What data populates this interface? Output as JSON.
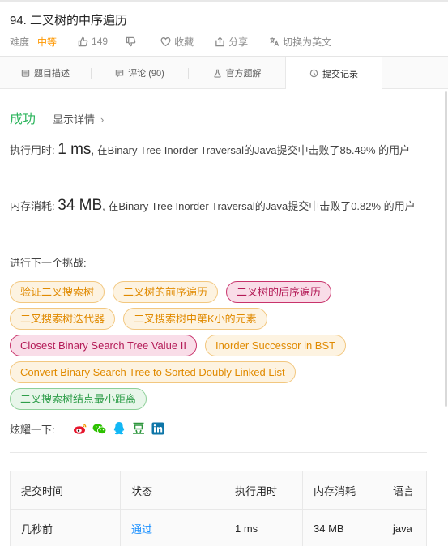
{
  "problem": {
    "title": "94. 二叉树的中序遍历",
    "difficulty_label": "难度",
    "difficulty": "中等",
    "likes": "149",
    "favorite_label": "收藏",
    "share_label": "分享",
    "switch_lang_label": "切换为英文"
  },
  "tabs": [
    {
      "label": "题目描述",
      "icon": "document-icon"
    },
    {
      "label": "评论 (90)",
      "icon": "comment-icon"
    },
    {
      "label": "官方题解",
      "icon": "flask-icon"
    },
    {
      "label": "提交记录",
      "icon": "clock-icon"
    }
  ],
  "result": {
    "status": "成功",
    "detail_link": "显示详情",
    "runtime_prefix": "执行用时:",
    "runtime_value": "1 ms",
    "runtime_suffix": ", 在Binary Tree Inorder Traversal的Java提交中击败了85.49% 的用户",
    "memory_prefix": "内存消耗:",
    "memory_value": "34 MB",
    "memory_suffix": ", 在Binary Tree Inorder Traversal的Java提交中击败了0.82% 的用户"
  },
  "challenge": {
    "title": "进行下一个挑战:",
    "rows": [
      [
        {
          "label": "验证二叉搜索树",
          "level": "medium"
        },
        {
          "label": "二叉树的前序遍历",
          "level": "medium"
        },
        {
          "label": "二叉树的后序遍历",
          "level": "hard"
        }
      ],
      [
        {
          "label": "二叉搜索树迭代器",
          "level": "medium"
        },
        {
          "label": "二叉搜索树中第K小的元素",
          "level": "medium"
        }
      ],
      [
        {
          "label": "Closest Binary Search Tree Value II",
          "level": "hard"
        },
        {
          "label": "Inorder Successor in BST",
          "level": "medium"
        }
      ],
      [
        {
          "label": "Convert Binary Search Tree to Sorted Doubly Linked List",
          "level": "medium"
        }
      ],
      [
        {
          "label": "二叉搜索树结点最小距离",
          "level": "green"
        }
      ]
    ]
  },
  "share": {
    "label": "炫耀一下:",
    "icons": [
      "weibo-icon",
      "wechat-icon",
      "qq-icon",
      "douban-icon",
      "linkedin-icon"
    ]
  },
  "colors": {
    "success": "#2db55d",
    "medium": "#e08a00",
    "hard": "#b41b57",
    "easy": "#2f9e4a",
    "link": "#1a90ff"
  },
  "submissions": {
    "headers": [
      "提交时间",
      "状态",
      "执行用时",
      "内存消耗",
      "语言"
    ],
    "rows": [
      [
        "几秒前",
        "通过",
        "1 ms",
        "34 MB",
        "java"
      ]
    ]
  }
}
